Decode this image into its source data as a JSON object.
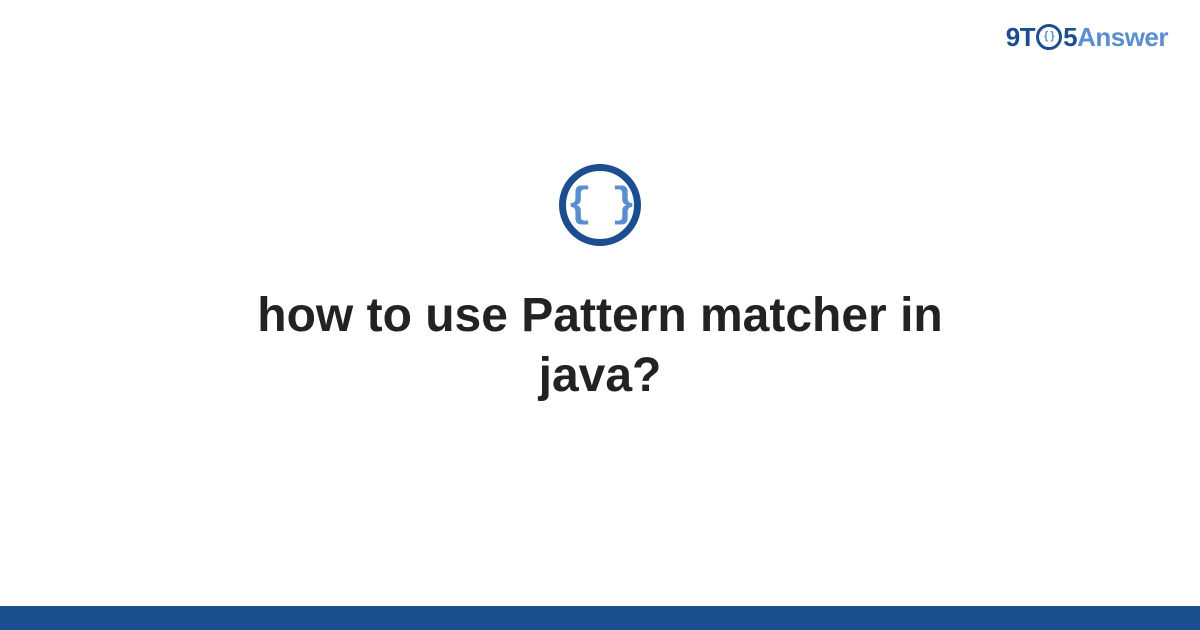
{
  "logo": {
    "part_9t": "9T",
    "o_inner": "{ }",
    "part_5": "5",
    "part_answer": "Answer"
  },
  "icon": {
    "braces": "{ }"
  },
  "question": {
    "title": "how to use Pattern matcher in java?"
  },
  "colors": {
    "brand_dark": "#1b4e8f",
    "brand_light": "#5a8fcf",
    "text_heading": "#222222"
  }
}
